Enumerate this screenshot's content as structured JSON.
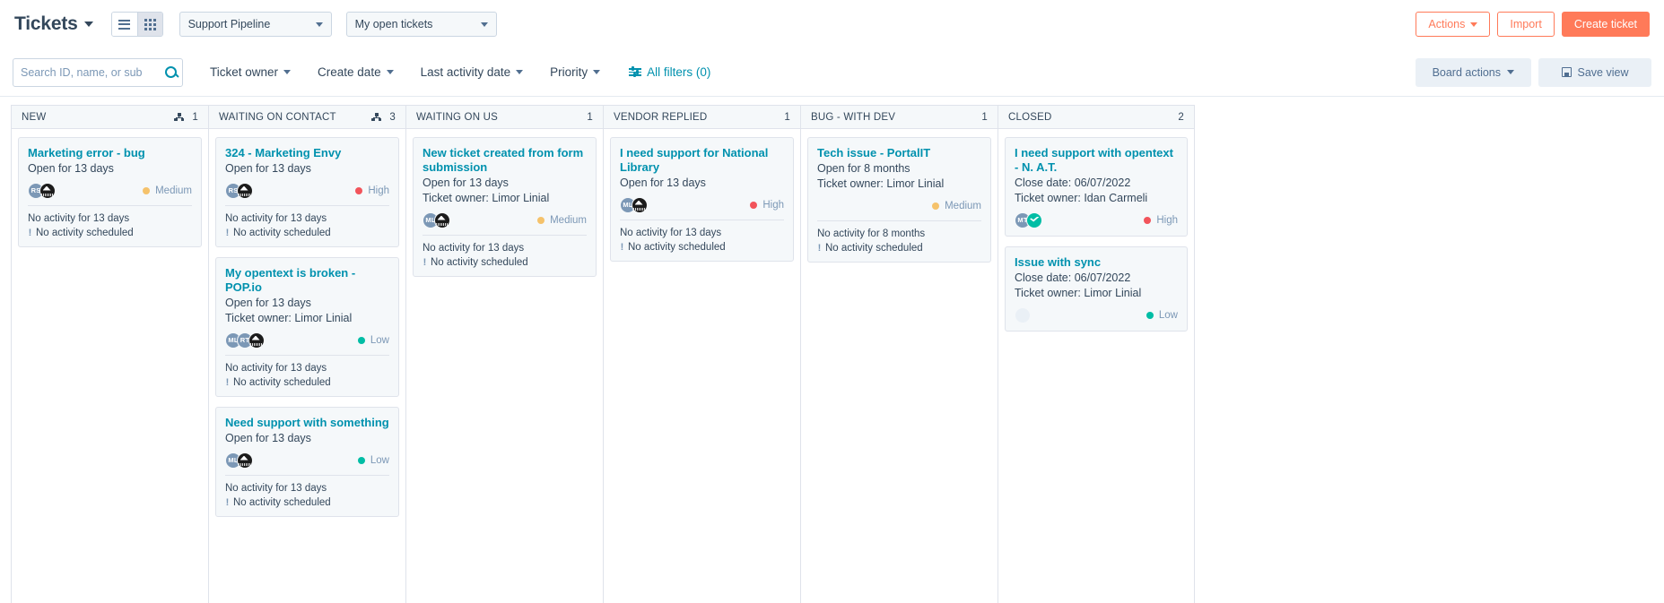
{
  "header": {
    "title": "Tickets",
    "view_toggle": {
      "list": "list-view",
      "board": "board-view",
      "active": "board"
    },
    "pipeline_select": "Support Pipeline",
    "owner_select": "My open tickets",
    "actions_label": "Actions",
    "import_label": "Import",
    "create_label": "Create ticket"
  },
  "filters": {
    "search_placeholder": "Search ID, name, or sub",
    "search_value": "",
    "ticket_owner": "Ticket owner",
    "create_date": "Create date",
    "last_activity_date": "Last activity date",
    "priority": "Priority",
    "all_filters": "All filters (0)",
    "board_actions": "Board actions",
    "save_view": "Save view"
  },
  "colors": {
    "accent": "#ff7a59",
    "link": "#0091ae",
    "text": "#33475b",
    "high": "#f2545b",
    "medium": "#f5c26b",
    "low": "#00bda5"
  },
  "columns": [
    {
      "name": "NEW",
      "count": "1",
      "has_workflow_icon": true,
      "cards": [
        {
          "title": "Marketing error - bug",
          "open_for": "Open for 13 days",
          "owner": "",
          "close_date": "",
          "avatars": [
            {
              "type": "initials",
              "label": "RS",
              "style": "av-blue"
            },
            {
              "type": "logo",
              "label": "",
              "style": "av-dark"
            }
          ],
          "priority": "Medium",
          "priority_level": "medium",
          "priority_inline": true,
          "activity": "No activity for 13 days",
          "scheduled": "No activity scheduled"
        }
      ]
    },
    {
      "name": "WAITING ON CONTACT",
      "count": "3",
      "has_workflow_icon": true,
      "cards": [
        {
          "title": "324 - Marketing Envy",
          "open_for": "Open for 13 days",
          "owner": "",
          "close_date": "",
          "avatars": [
            {
              "type": "initials",
              "label": "RS",
              "style": "av-blue"
            },
            {
              "type": "logo",
              "label": "",
              "style": "av-dark"
            }
          ],
          "priority": "High",
          "priority_level": "high",
          "priority_inline": true,
          "activity": "No activity for 13 days",
          "scheduled": "No activity scheduled"
        },
        {
          "title": "My opentext is broken - POP.io",
          "open_for": "Open for 13 days",
          "owner": "Ticket owner: Limor Linial",
          "close_date": "",
          "avatars": [
            {
              "type": "initials",
              "label": "ML",
              "style": "av-blue"
            },
            {
              "type": "initials",
              "label": "RT",
              "style": "av-blue"
            },
            {
              "type": "logo",
              "label": "",
              "style": "av-dark"
            }
          ],
          "priority": "Low",
          "priority_level": "low",
          "priority_inline": true,
          "activity": "No activity for 13 days",
          "scheduled": "No activity scheduled"
        },
        {
          "title": "Need support with something",
          "open_for": "Open for 13 days",
          "owner": "",
          "close_date": "",
          "avatars": [
            {
              "type": "initials",
              "label": "ML",
              "style": "av-blue"
            },
            {
              "type": "logo",
              "label": "",
              "style": "av-dark"
            }
          ],
          "priority": "Low",
          "priority_level": "low",
          "priority_inline": true,
          "activity": "No activity for 13 days",
          "scheduled": "No activity scheduled"
        }
      ]
    },
    {
      "name": "WAITING ON US",
      "count": "1",
      "has_workflow_icon": false,
      "cards": [
        {
          "title": "New ticket created from form submission",
          "open_for": "Open for 13 days",
          "owner": "Ticket owner: Limor Linial",
          "close_date": "",
          "avatars": [
            {
              "type": "initials",
              "label": "ML",
              "style": "av-blue"
            },
            {
              "type": "logo",
              "label": "",
              "style": "av-dark"
            }
          ],
          "priority": "Medium",
          "priority_level": "medium",
          "priority_inline": true,
          "activity": "No activity for 13 days",
          "scheduled": "No activity scheduled"
        }
      ]
    },
    {
      "name": "VENDOR REPLIED",
      "count": "1",
      "has_workflow_icon": false,
      "cards": [
        {
          "title": "I need support for National Library",
          "open_for": "Open for 13 days",
          "owner": "",
          "close_date": "",
          "avatars": [
            {
              "type": "initials",
              "label": "ML",
              "style": "av-blue"
            },
            {
              "type": "logo",
              "label": "",
              "style": "av-dark"
            }
          ],
          "priority": "High",
          "priority_level": "high",
          "priority_inline": true,
          "activity": "No activity for 13 days",
          "scheduled": "No activity scheduled"
        }
      ]
    },
    {
      "name": "BUG - WITH DEV",
      "count": "1",
      "has_workflow_icon": false,
      "cards": [
        {
          "title": "Tech issue - PortalIT",
          "open_for": "Open for 8 months",
          "owner": "Ticket owner: Limor Linial",
          "close_date": "",
          "avatars": [],
          "priority": "Medium",
          "priority_level": "medium",
          "priority_inline": false,
          "activity": "No activity for 8 months",
          "scheduled": "No activity scheduled"
        }
      ]
    },
    {
      "name": "CLOSED",
      "count": "2",
      "has_workflow_icon": false,
      "cards": [
        {
          "title": "I need support with opentext - N. A.T.",
          "open_for": "",
          "owner": "Ticket owner: Idan Carmeli",
          "close_date": "Close date: 06/07/2022",
          "avatars": [
            {
              "type": "initials",
              "label": "MT",
              "style": "av-blue"
            },
            {
              "type": "logo",
              "label": "",
              "style": "av-green"
            }
          ],
          "priority": "High",
          "priority_level": "high",
          "priority_inline": true,
          "activity": "",
          "scheduled": ""
        },
        {
          "title": "Issue with sync",
          "open_for": "",
          "owner": "Ticket owner: Limor Linial",
          "close_date": "Close date: 06/07/2022",
          "avatars": [
            {
              "type": "empty",
              "label": "",
              "style": "av-empty"
            }
          ],
          "priority": "Low",
          "priority_level": "low",
          "priority_inline": true,
          "activity": "",
          "scheduled": ""
        }
      ]
    }
  ]
}
